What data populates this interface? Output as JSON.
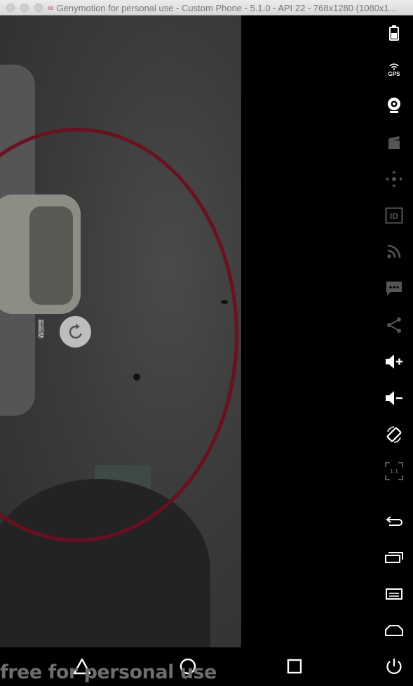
{
  "window": {
    "title_logo": "∞",
    "title": "Genymotion for personal use - Custom Phone - 5.1.0 - API 22 - 768x1280 (1080x1..."
  },
  "screen": {
    "side_glyph": "劃劃模"
  },
  "watermark": "free for personal use",
  "colors": {
    "toolbar_bg": "#000000",
    "icon_active": "#ffffff",
    "icon_disabled": "#555555",
    "target_ring": "#6a1020"
  },
  "toolbar": {
    "items": [
      {
        "name": "battery-icon",
        "enabled": true
      },
      {
        "name": "gps-icon",
        "label": "GPS",
        "enabled": true
      },
      {
        "name": "webcam-icon",
        "enabled": true
      },
      {
        "name": "capture-icon",
        "enabled": false
      },
      {
        "name": "dpad-icon",
        "enabled": false
      },
      {
        "name": "device-id-icon",
        "label": "ID",
        "enabled": false
      },
      {
        "name": "network-icon",
        "enabled": false
      },
      {
        "name": "sms-icon",
        "enabled": false
      },
      {
        "name": "share-icon",
        "enabled": false
      },
      {
        "name": "volume-up-icon",
        "enabled": true
      },
      {
        "name": "volume-down-icon",
        "enabled": true
      },
      {
        "name": "rotate-icon",
        "enabled": true
      },
      {
        "name": "pixel-perfect-icon",
        "label": "1:1",
        "enabled": false
      },
      {
        "name": "back-icon",
        "enabled": true
      },
      {
        "name": "recent-apps-icon",
        "enabled": true
      },
      {
        "name": "menu-icon",
        "enabled": true
      },
      {
        "name": "home-icon",
        "enabled": true
      },
      {
        "name": "power-icon",
        "enabled": true
      }
    ]
  },
  "navbar": {
    "items": [
      "back-triangle-icon",
      "home-circle-icon",
      "recents-square-icon"
    ]
  }
}
